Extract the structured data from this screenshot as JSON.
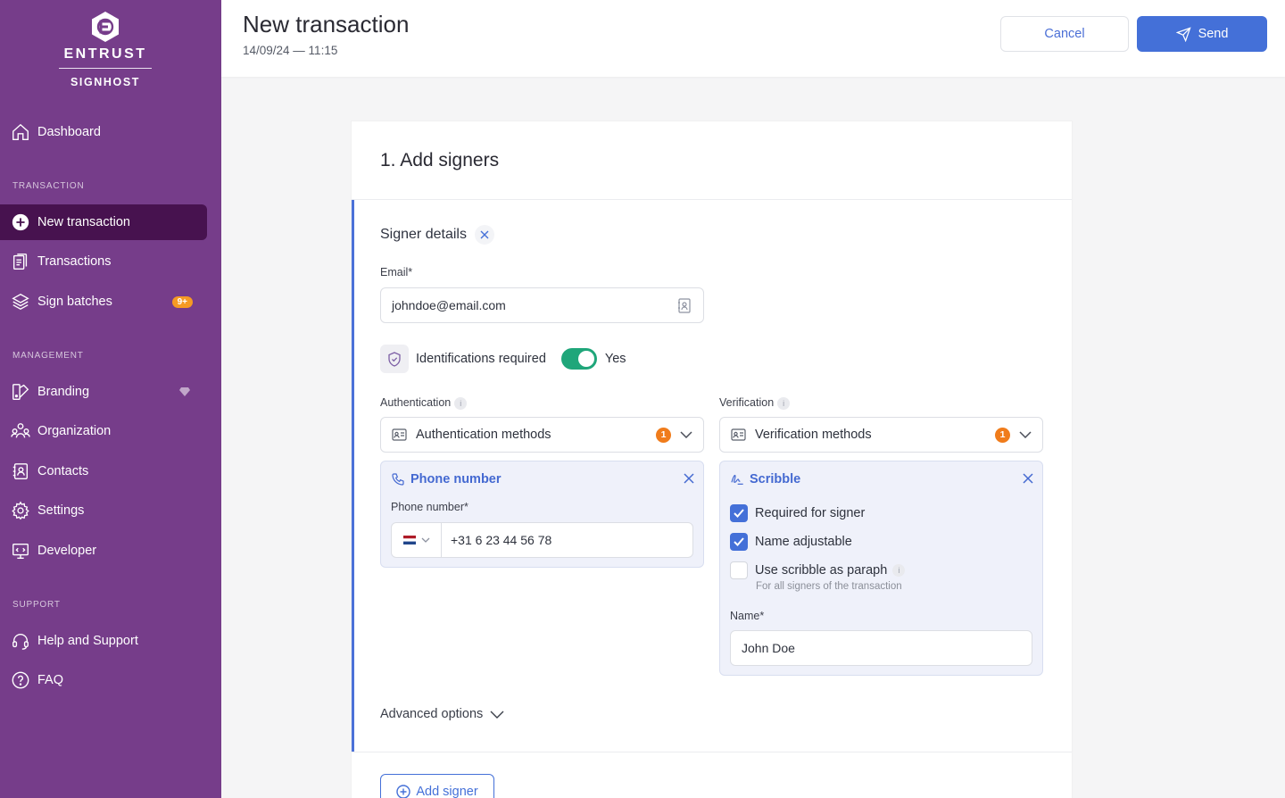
{
  "brand": {
    "name": "ENTRUST",
    "product": "SIGNHOST"
  },
  "sidebar": {
    "dashboard": "Dashboard",
    "section_transaction": "TRANSACTION",
    "new_transaction": "New transaction",
    "transactions": "Transactions",
    "sign_batches": "Sign batches",
    "sign_batches_badge": "9+",
    "section_management": "MANAGEMENT",
    "branding": "Branding",
    "organization": "Organization",
    "contacts": "Contacts",
    "settings": "Settings",
    "developer": "Developer",
    "section_support": "SUPPORT",
    "help": "Help and Support",
    "faq": "FAQ"
  },
  "header": {
    "title": "New transaction",
    "date": "14/09/24 — 11:15",
    "cancel_label": "Cancel",
    "send_label": "Send"
  },
  "card": {
    "title": "1. Add signers",
    "signer_title": "Signer details",
    "email_label": "Email*",
    "email_value": "johndoe@email.com",
    "identifications_label": "Identifications required",
    "identifications_value": "Yes",
    "authentication_label": "Authentication",
    "authentication_placeholder": "Authentication methods",
    "authentication_count": "1",
    "verification_label": "Verification",
    "verification_placeholder": "Verification methods",
    "verification_count": "1",
    "phone_panel": {
      "title": "Phone number",
      "field_label": "Phone number*",
      "value": "+31 6 23 44 56 78"
    },
    "scribble_panel": {
      "title": "Scribble",
      "required": "Required for signer",
      "name_adjustable": "Name adjustable",
      "use_paraph": "Use scribble as paraph",
      "paraph_hint": "For all signers of the transaction",
      "name_label": "Name*",
      "name_value": "John Doe"
    },
    "advanced_options": "Advanced options",
    "add_signer": "Add signer"
  },
  "colors": {
    "sidebar_bg": "#763d8a",
    "sidebar_active": "#47124f",
    "accent": "#4470d8",
    "toggle_on": "#1fa67a",
    "badge": "#f07c1b"
  }
}
